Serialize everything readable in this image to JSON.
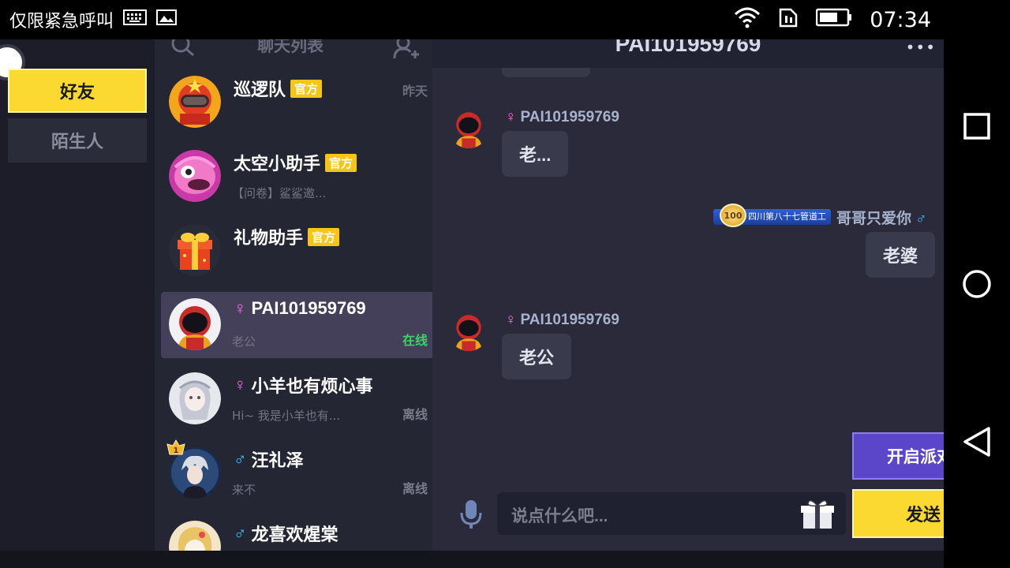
{
  "status_bar": {
    "emergency_text": "仅限紧急呼叫",
    "time": "07:34",
    "icons": [
      "keyboard-icon",
      "image-icon",
      "wifi-icon",
      "sim-icon",
      "battery-icon"
    ]
  },
  "nav": {
    "icons": [
      "recents-square-icon",
      "home-circle-icon",
      "back-triangle-icon"
    ]
  },
  "categories": {
    "friends": "好友",
    "strangers": "陌生人"
  },
  "chat_list": {
    "title": "聊天列表",
    "items": [
      {
        "name": "巡逻队",
        "badge": "官方",
        "preview": "",
        "time": "昨天",
        "status": ""
      },
      {
        "name": "太空小助手",
        "badge": "官方",
        "preview": "【问卷】鲨鲨邀...",
        "time": "",
        "status": ""
      },
      {
        "name": "礼物助手",
        "badge": "官方",
        "preview": "",
        "time": "",
        "status": ""
      },
      {
        "name": "PAI101959769",
        "gender": "♀",
        "preview": "老公",
        "status": "在线"
      },
      {
        "name": "小羊也有烦心事",
        "gender": "♀",
        "preview": "Hi~ 我是小羊也有...",
        "status": "离线"
      },
      {
        "name": "汪礼泽",
        "gender": "♂",
        "preview": "来不",
        "status": "离线"
      },
      {
        "name": "龙喜欢煋棠",
        "gender": "♂",
        "preview": "",
        "status": ""
      }
    ]
  },
  "conversation": {
    "title": "PAI101959769",
    "more": "•••",
    "messages": [
      {
        "sender": "PAI101959769",
        "gender": "♀",
        "text": "老..."
      },
      {
        "sender": "哥哥只爱你",
        "gender": "♂",
        "rank_medal": "100",
        "rank_title": "四川第八十七管道工",
        "text": "老婆"
      },
      {
        "sender": "PAI101959769",
        "gender": "♀",
        "text": "老公"
      }
    ],
    "input_placeholder": "说点什么吧...",
    "party_button": "开启派对",
    "send_button": "发送"
  },
  "colors": {
    "accent_yellow": "#fbd931",
    "party_purple": "#5b46c9",
    "online_green": "#3cd26a",
    "female_pink": "#ff6ee0",
    "male_blue": "#41c2ff"
  }
}
